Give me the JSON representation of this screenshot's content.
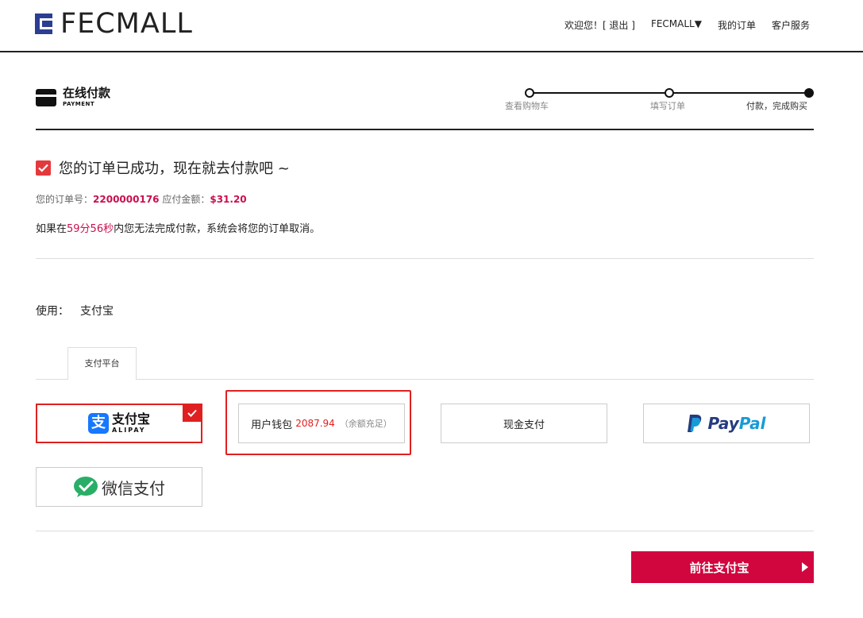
{
  "header": {
    "logo_text": "FECMALL",
    "nav": {
      "welcome": "欢迎您！[ 退出 ]",
      "store": "FECMALL▼",
      "my_orders": "我的订单",
      "customer_service": "客户服务"
    }
  },
  "page": {
    "title_cn": "在线付款",
    "title_en": "PAYMENT"
  },
  "steps": [
    {
      "label": "查看购物车"
    },
    {
      "label": "填写订单"
    },
    {
      "label": "付款，完成购买"
    }
  ],
  "success": {
    "message": "您的订单已成功，现在就去付款吧 ~",
    "order_no_label": "您的订单号：",
    "order_no": "2200000176",
    "amount_label": " 应付金额：",
    "amount": "$31.20",
    "timeout_prefix": "如果在",
    "timeout_time": "59分56秒",
    "timeout_suffix": "内您无法完成付款，系统会将您的订单取消。"
  },
  "payment": {
    "use_label": "使用：",
    "use_value": "支付宝",
    "tab_label": "支付平台",
    "alipay_cn": "支付宝",
    "alipay_en": "ALIPAY",
    "wallet_label": "用户钱包",
    "wallet_amount": "2087.94",
    "wallet_note": "（余额充足）",
    "cash_label": "现金支付",
    "paypal_1": "Pay",
    "paypal_2": "Pal",
    "wechat_label": "微信支付"
  },
  "action": {
    "go_label": "前往支付宝"
  },
  "colors": {
    "accent": "#d1063f",
    "selected_border": "#e02020",
    "alipay_blue": "#1677ff",
    "paypal_dark": "#253b80",
    "paypal_light": "#179bd7",
    "wechat_green": "#2aae67"
  }
}
